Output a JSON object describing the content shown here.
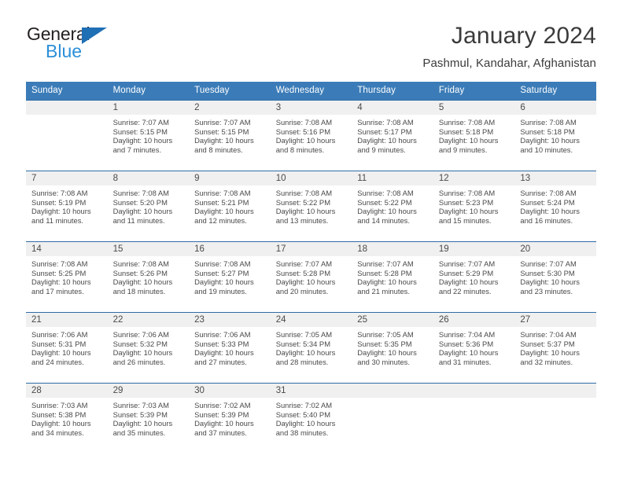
{
  "brand": {
    "name_part1": "General",
    "name_part2": "Blue",
    "triangle_color": "#1f6fb5",
    "blue_text_color": "#2b8fd8"
  },
  "header": {
    "title": "January 2024",
    "subtitle": "Pashmul, Kandahar, Afghanistan"
  },
  "theme": {
    "header_band": "#3b7cb8",
    "row_divider": "#2f6ca6",
    "daynum_band": "#f0f0f0",
    "text": "#4a4a4a"
  },
  "weekday_headers": [
    "Sunday",
    "Monday",
    "Tuesday",
    "Wednesday",
    "Thursday",
    "Friday",
    "Saturday"
  ],
  "weeks": [
    [
      {
        "day": "",
        "sunrise": "",
        "sunset": "",
        "daylight_line1": "",
        "daylight_line2": ""
      },
      {
        "day": "1",
        "sunrise": "Sunrise: 7:07 AM",
        "sunset": "Sunset: 5:15 PM",
        "daylight_line1": "Daylight: 10 hours",
        "daylight_line2": "and 7 minutes."
      },
      {
        "day": "2",
        "sunrise": "Sunrise: 7:07 AM",
        "sunset": "Sunset: 5:15 PM",
        "daylight_line1": "Daylight: 10 hours",
        "daylight_line2": "and 8 minutes."
      },
      {
        "day": "3",
        "sunrise": "Sunrise: 7:08 AM",
        "sunset": "Sunset: 5:16 PM",
        "daylight_line1": "Daylight: 10 hours",
        "daylight_line2": "and 8 minutes."
      },
      {
        "day": "4",
        "sunrise": "Sunrise: 7:08 AM",
        "sunset": "Sunset: 5:17 PM",
        "daylight_line1": "Daylight: 10 hours",
        "daylight_line2": "and 9 minutes."
      },
      {
        "day": "5",
        "sunrise": "Sunrise: 7:08 AM",
        "sunset": "Sunset: 5:18 PM",
        "daylight_line1": "Daylight: 10 hours",
        "daylight_line2": "and 9 minutes."
      },
      {
        "day": "6",
        "sunrise": "Sunrise: 7:08 AM",
        "sunset": "Sunset: 5:18 PM",
        "daylight_line1": "Daylight: 10 hours",
        "daylight_line2": "and 10 minutes."
      }
    ],
    [
      {
        "day": "7",
        "sunrise": "Sunrise: 7:08 AM",
        "sunset": "Sunset: 5:19 PM",
        "daylight_line1": "Daylight: 10 hours",
        "daylight_line2": "and 11 minutes."
      },
      {
        "day": "8",
        "sunrise": "Sunrise: 7:08 AM",
        "sunset": "Sunset: 5:20 PM",
        "daylight_line1": "Daylight: 10 hours",
        "daylight_line2": "and 11 minutes."
      },
      {
        "day": "9",
        "sunrise": "Sunrise: 7:08 AM",
        "sunset": "Sunset: 5:21 PM",
        "daylight_line1": "Daylight: 10 hours",
        "daylight_line2": "and 12 minutes."
      },
      {
        "day": "10",
        "sunrise": "Sunrise: 7:08 AM",
        "sunset": "Sunset: 5:22 PM",
        "daylight_line1": "Daylight: 10 hours",
        "daylight_line2": "and 13 minutes."
      },
      {
        "day": "11",
        "sunrise": "Sunrise: 7:08 AM",
        "sunset": "Sunset: 5:22 PM",
        "daylight_line1": "Daylight: 10 hours",
        "daylight_line2": "and 14 minutes."
      },
      {
        "day": "12",
        "sunrise": "Sunrise: 7:08 AM",
        "sunset": "Sunset: 5:23 PM",
        "daylight_line1": "Daylight: 10 hours",
        "daylight_line2": "and 15 minutes."
      },
      {
        "day": "13",
        "sunrise": "Sunrise: 7:08 AM",
        "sunset": "Sunset: 5:24 PM",
        "daylight_line1": "Daylight: 10 hours",
        "daylight_line2": "and 16 minutes."
      }
    ],
    [
      {
        "day": "14",
        "sunrise": "Sunrise: 7:08 AM",
        "sunset": "Sunset: 5:25 PM",
        "daylight_line1": "Daylight: 10 hours",
        "daylight_line2": "and 17 minutes."
      },
      {
        "day": "15",
        "sunrise": "Sunrise: 7:08 AM",
        "sunset": "Sunset: 5:26 PM",
        "daylight_line1": "Daylight: 10 hours",
        "daylight_line2": "and 18 minutes."
      },
      {
        "day": "16",
        "sunrise": "Sunrise: 7:08 AM",
        "sunset": "Sunset: 5:27 PM",
        "daylight_line1": "Daylight: 10 hours",
        "daylight_line2": "and 19 minutes."
      },
      {
        "day": "17",
        "sunrise": "Sunrise: 7:07 AM",
        "sunset": "Sunset: 5:28 PM",
        "daylight_line1": "Daylight: 10 hours",
        "daylight_line2": "and 20 minutes."
      },
      {
        "day": "18",
        "sunrise": "Sunrise: 7:07 AM",
        "sunset": "Sunset: 5:28 PM",
        "daylight_line1": "Daylight: 10 hours",
        "daylight_line2": "and 21 minutes."
      },
      {
        "day": "19",
        "sunrise": "Sunrise: 7:07 AM",
        "sunset": "Sunset: 5:29 PM",
        "daylight_line1": "Daylight: 10 hours",
        "daylight_line2": "and 22 minutes."
      },
      {
        "day": "20",
        "sunrise": "Sunrise: 7:07 AM",
        "sunset": "Sunset: 5:30 PM",
        "daylight_line1": "Daylight: 10 hours",
        "daylight_line2": "and 23 minutes."
      }
    ],
    [
      {
        "day": "21",
        "sunrise": "Sunrise: 7:06 AM",
        "sunset": "Sunset: 5:31 PM",
        "daylight_line1": "Daylight: 10 hours",
        "daylight_line2": "and 24 minutes."
      },
      {
        "day": "22",
        "sunrise": "Sunrise: 7:06 AM",
        "sunset": "Sunset: 5:32 PM",
        "daylight_line1": "Daylight: 10 hours",
        "daylight_line2": "and 26 minutes."
      },
      {
        "day": "23",
        "sunrise": "Sunrise: 7:06 AM",
        "sunset": "Sunset: 5:33 PM",
        "daylight_line1": "Daylight: 10 hours",
        "daylight_line2": "and 27 minutes."
      },
      {
        "day": "24",
        "sunrise": "Sunrise: 7:05 AM",
        "sunset": "Sunset: 5:34 PM",
        "daylight_line1": "Daylight: 10 hours",
        "daylight_line2": "and 28 minutes."
      },
      {
        "day": "25",
        "sunrise": "Sunrise: 7:05 AM",
        "sunset": "Sunset: 5:35 PM",
        "daylight_line1": "Daylight: 10 hours",
        "daylight_line2": "and 30 minutes."
      },
      {
        "day": "26",
        "sunrise": "Sunrise: 7:04 AM",
        "sunset": "Sunset: 5:36 PM",
        "daylight_line1": "Daylight: 10 hours",
        "daylight_line2": "and 31 minutes."
      },
      {
        "day": "27",
        "sunrise": "Sunrise: 7:04 AM",
        "sunset": "Sunset: 5:37 PM",
        "daylight_line1": "Daylight: 10 hours",
        "daylight_line2": "and 32 minutes."
      }
    ],
    [
      {
        "day": "28",
        "sunrise": "Sunrise: 7:03 AM",
        "sunset": "Sunset: 5:38 PM",
        "daylight_line1": "Daylight: 10 hours",
        "daylight_line2": "and 34 minutes."
      },
      {
        "day": "29",
        "sunrise": "Sunrise: 7:03 AM",
        "sunset": "Sunset: 5:39 PM",
        "daylight_line1": "Daylight: 10 hours",
        "daylight_line2": "and 35 minutes."
      },
      {
        "day": "30",
        "sunrise": "Sunrise: 7:02 AM",
        "sunset": "Sunset: 5:39 PM",
        "daylight_line1": "Daylight: 10 hours",
        "daylight_line2": "and 37 minutes."
      },
      {
        "day": "31",
        "sunrise": "Sunrise: 7:02 AM",
        "sunset": "Sunset: 5:40 PM",
        "daylight_line1": "Daylight: 10 hours",
        "daylight_line2": "and 38 minutes."
      },
      {
        "day": "",
        "sunrise": "",
        "sunset": "",
        "daylight_line1": "",
        "daylight_line2": ""
      },
      {
        "day": "",
        "sunrise": "",
        "sunset": "",
        "daylight_line1": "",
        "daylight_line2": ""
      },
      {
        "day": "",
        "sunrise": "",
        "sunset": "",
        "daylight_line1": "",
        "daylight_line2": ""
      }
    ]
  ]
}
